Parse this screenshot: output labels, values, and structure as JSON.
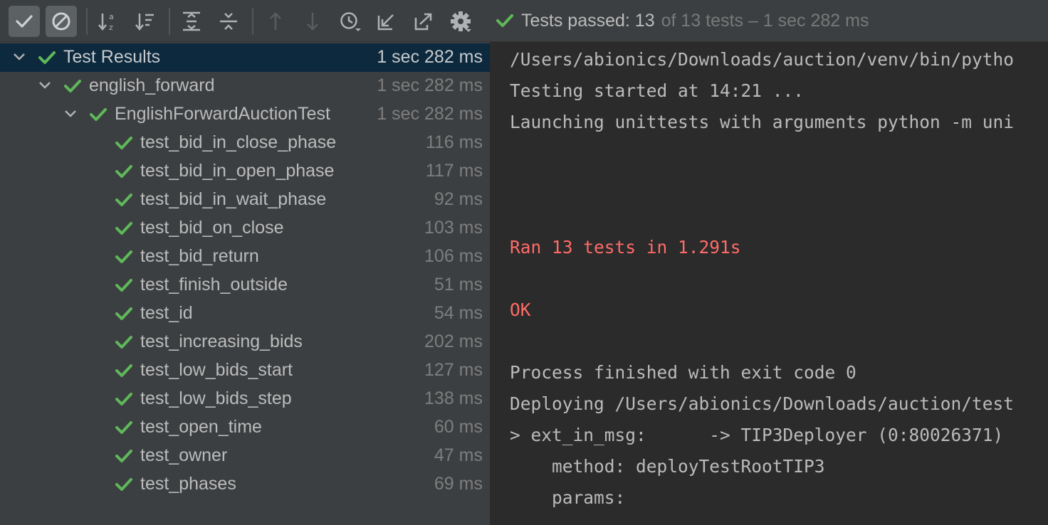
{
  "toolbar": {
    "buttons": [
      {
        "icon": "show-passed-icon",
        "active": true
      },
      {
        "icon": "show-ignored-icon",
        "active": true
      },
      {
        "icon": "sort-alphabetically-icon"
      },
      {
        "icon": "sort-by-duration-icon"
      },
      {
        "icon": "expand-all-icon"
      },
      {
        "icon": "collapse-all-icon"
      },
      {
        "icon": "previous-failed-test-icon",
        "disabled": true
      },
      {
        "icon": "next-failed-test-icon",
        "disabled": true
      },
      {
        "icon": "test-history-icon"
      },
      {
        "icon": "import-tests-icon"
      },
      {
        "icon": "export-test-results-icon"
      },
      {
        "icon": "settings-gear-icon"
      }
    ],
    "status": {
      "icon": "check-icon",
      "main": "Tests passed: 13",
      "rest": "of 13 tests – 1 sec 282 ms"
    }
  },
  "tree": {
    "root": {
      "name": "Test Results",
      "duration": "1 sec 282 ms"
    },
    "module": {
      "name": "english_forward",
      "duration": "1 sec 282 ms"
    },
    "suite": {
      "name": "EnglishForwardAuctionTest",
      "duration": "1 sec 282 ms"
    },
    "tests": [
      {
        "name": "test_bid_in_close_phase",
        "duration": "116 ms"
      },
      {
        "name": "test_bid_in_open_phase",
        "duration": "117 ms"
      },
      {
        "name": "test_bid_in_wait_phase",
        "duration": "92 ms"
      },
      {
        "name": "test_bid_on_close",
        "duration": "103 ms"
      },
      {
        "name": "test_bid_return",
        "duration": "106 ms"
      },
      {
        "name": "test_finish_outside",
        "duration": "51 ms"
      },
      {
        "name": "test_id",
        "duration": "54 ms"
      },
      {
        "name": "test_increasing_bids",
        "duration": "202 ms"
      },
      {
        "name": "test_low_bids_start",
        "duration": "127 ms"
      },
      {
        "name": "test_low_bids_step",
        "duration": "138 ms"
      },
      {
        "name": "test_open_time",
        "duration": "60 ms"
      },
      {
        "name": "test_owner",
        "duration": "47 ms"
      },
      {
        "name": "test_phases",
        "duration": "69 ms"
      }
    ]
  },
  "console": {
    "lines": [
      "/Users/abionics/Downloads/auction/venv/bin/pytho",
      "Testing started at 14:21 ...",
      "Launching unittests with arguments python -m uni",
      "Ran 13 tests in 1.291s",
      "OK",
      "Process finished with exit code 0",
      "Deploying /Users/abionics/Downloads/auction/test",
      "> ext_in_msg:      -> TIP3Deployer (0:80026371)",
      "    method: deployTestRootTIP3",
      "    params:"
    ]
  },
  "colors": {
    "pass_green": "#5fb85a",
    "error_red": "#ff6b68",
    "selection": "#0d293e",
    "panel_bg": "#3c3f41",
    "console_bg": "#2b2b2b"
  }
}
